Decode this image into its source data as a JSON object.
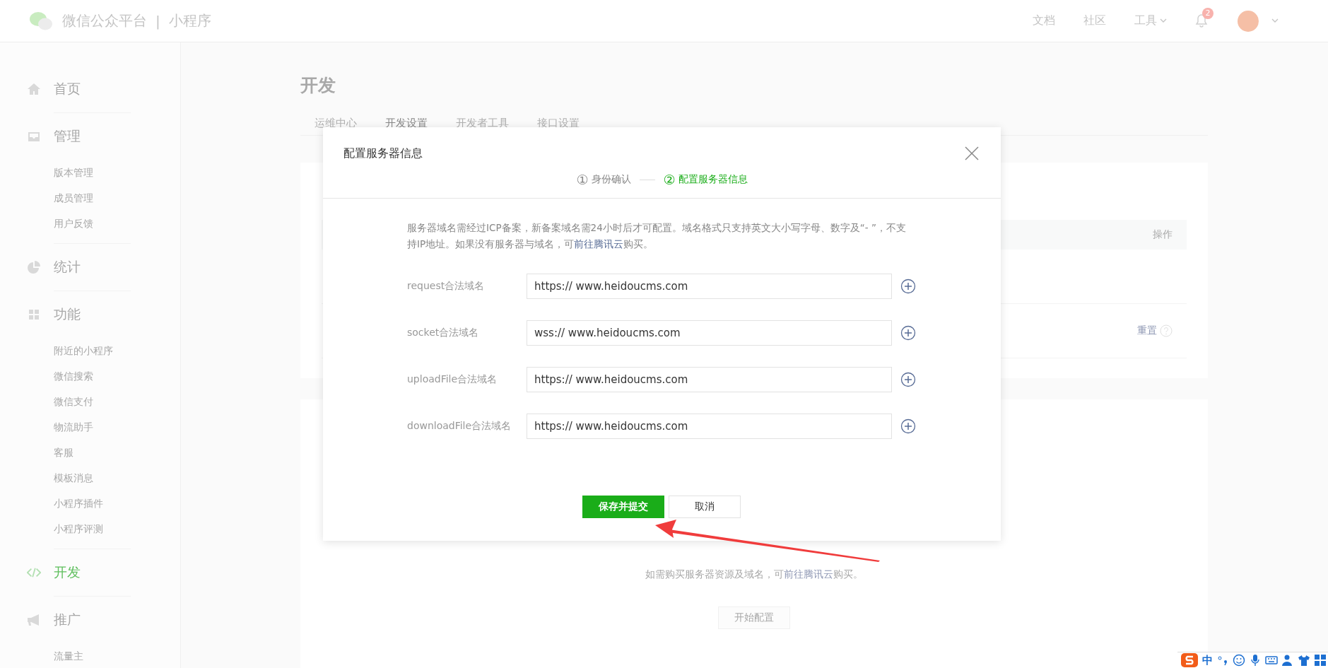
{
  "header": {
    "brand": "微信公众平台",
    "divider": "|",
    "product": "小程序",
    "links": [
      "文档",
      "社区"
    ],
    "tools_menu": "工具",
    "notification_count": "2"
  },
  "sidebar": {
    "sections": [
      {
        "title": "首页",
        "kind": "home",
        "selected": false
      },
      {
        "title": "管理",
        "kind": "inbox",
        "selected": false,
        "items": [
          {
            "label": "版本管理",
            "selected": false
          },
          {
            "label": "成员管理",
            "selected": false
          },
          {
            "label": "用户反馈",
            "selected": false
          }
        ]
      },
      {
        "title": "统计",
        "kind": "pie",
        "selected": false
      },
      {
        "title": "功能",
        "kind": "grid",
        "selected": false,
        "items": [
          {
            "label": "附近的小程序",
            "selected": false
          },
          {
            "label": "微信搜索",
            "selected": false
          },
          {
            "label": "微信支付",
            "selected": false
          },
          {
            "label": "物流助手",
            "selected": false
          },
          {
            "label": "客服",
            "selected": false
          },
          {
            "label": "模板消息",
            "selected": false
          },
          {
            "label": "小程序插件",
            "selected": false
          },
          {
            "label": "小程序评测",
            "selected": false
          }
        ]
      },
      {
        "title": "开发",
        "kind": "code",
        "selected": true
      },
      {
        "title": "推广",
        "kind": "megaphone",
        "selected": false,
        "items": [
          {
            "label": "流量主",
            "selected": false
          }
        ]
      }
    ]
  },
  "main": {
    "title": "开发",
    "tabs": [
      {
        "label": "运维中心",
        "selected": false
      },
      {
        "label": "开发设置",
        "selected": true
      },
      {
        "label": "开发者工具",
        "selected": false
      },
      {
        "label": "接口设置",
        "selected": false
      }
    ],
    "table_action_header": "操作",
    "reset_link": "重置",
    "purchase_note": {
      "before": "如需购买服务器资源及域名，可",
      "link": "前往腾讯云",
      "after": "购买。"
    },
    "start_button": "开始配置"
  },
  "dialog": {
    "title": "配置服务器信息",
    "steps": [
      {
        "number": "①",
        "label": "身份确认",
        "selected": false
      },
      {
        "number": "②",
        "label": "配置服务器信息",
        "selected": true
      }
    ],
    "notice": {
      "before": "服务器域名需经过ICP备案，新备案域名需24小时后才可配置。域名格式只支持英文大小写字母、数字及“- ”，不支持IP地址。如果没有服务器与域名，可",
      "link": "前往腾讯云",
      "after": "购买。"
    },
    "fields": [
      {
        "label": "request合法域名",
        "value": "https:// www.heidoucms.com"
      },
      {
        "label": "socket合法域名",
        "value": "wss:// www.heidoucms.com"
      },
      {
        "label": "uploadFile合法域名",
        "value": "https:// www.heidoucms.com"
      },
      {
        "label": "downloadFile合法域名",
        "value": "https:// www.heidoucms.com"
      }
    ],
    "primary_button": "保存并提交",
    "secondary_button": "取消"
  },
  "ime_bar": {
    "mode": "中"
  }
}
